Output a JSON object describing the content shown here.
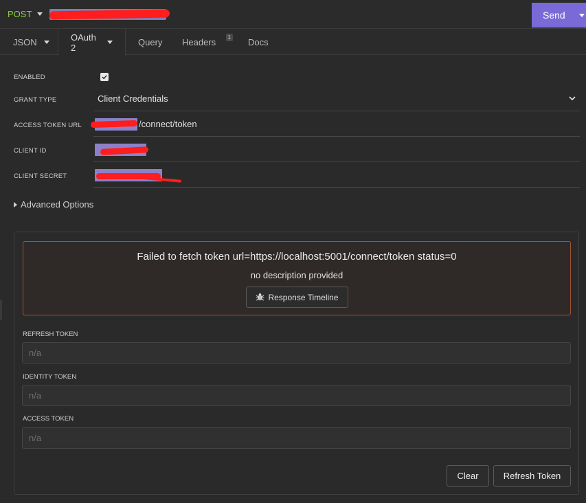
{
  "request": {
    "method": "POST",
    "send_label": "Send"
  },
  "tabs": [
    {
      "label": "JSON"
    },
    {
      "label": "OAuth 2"
    },
    {
      "label": "Query"
    },
    {
      "label": "Headers",
      "badge": "1"
    },
    {
      "label": "Docs"
    }
  ],
  "auth": {
    "enabled_label": "ENABLED",
    "enabled": true,
    "grant_type_label": "GRANT TYPE",
    "grant_type_value": "Client Credentials",
    "access_token_url_label": "ACCESS TOKEN URL",
    "access_token_url_suffix": "/connect/token",
    "client_id_label": "CLIENT ID",
    "client_secret_label": "CLIENT SECRET",
    "advanced_label": "Advanced Options"
  },
  "token_panel": {
    "error_title": "Failed to fetch token url=https://localhost:5001/connect/token status=0",
    "error_desc": "no description provided",
    "timeline_button": "Response Timeline",
    "refresh_token_label": "REFRESH TOKEN",
    "refresh_token_placeholder": "n/a",
    "identity_token_label": "IDENTITY TOKEN",
    "identity_token_placeholder": "n/a",
    "access_token_label": "ACCESS TOKEN",
    "access_token_placeholder": "n/a",
    "clear_button": "Clear",
    "refresh_button": "Refresh Token"
  },
  "colors": {
    "accent": "#7a6ad8",
    "method": "#8bcf3d",
    "error_border": "#a05638"
  }
}
